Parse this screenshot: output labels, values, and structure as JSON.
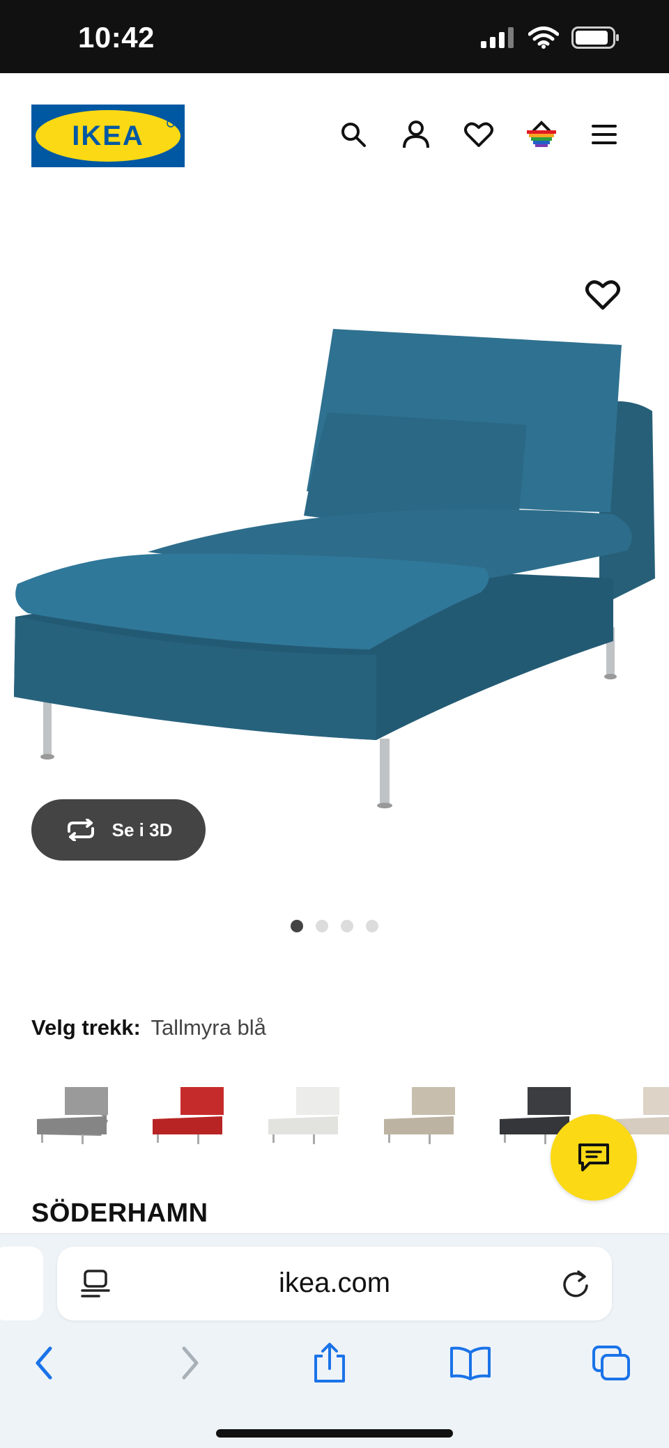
{
  "status_bar": {
    "time": "10:42"
  },
  "header": {
    "logo_text": "IKEA"
  },
  "product": {
    "view_3d_label": "Se i 3D",
    "image_count": 4,
    "active_image": 1,
    "variant_key": "Velg trekk:",
    "variant_value": "Tallmyra blå",
    "name": "SÖDERHAMN",
    "swatches": [
      "grey",
      "red",
      "white",
      "beige",
      "black",
      "light beige"
    ]
  },
  "browser": {
    "url": "ikea.com"
  },
  "colors": {
    "ikea_blue": "#0058a3",
    "ikea_yellow": "#fbd914",
    "sofa": "#2b6a85"
  }
}
